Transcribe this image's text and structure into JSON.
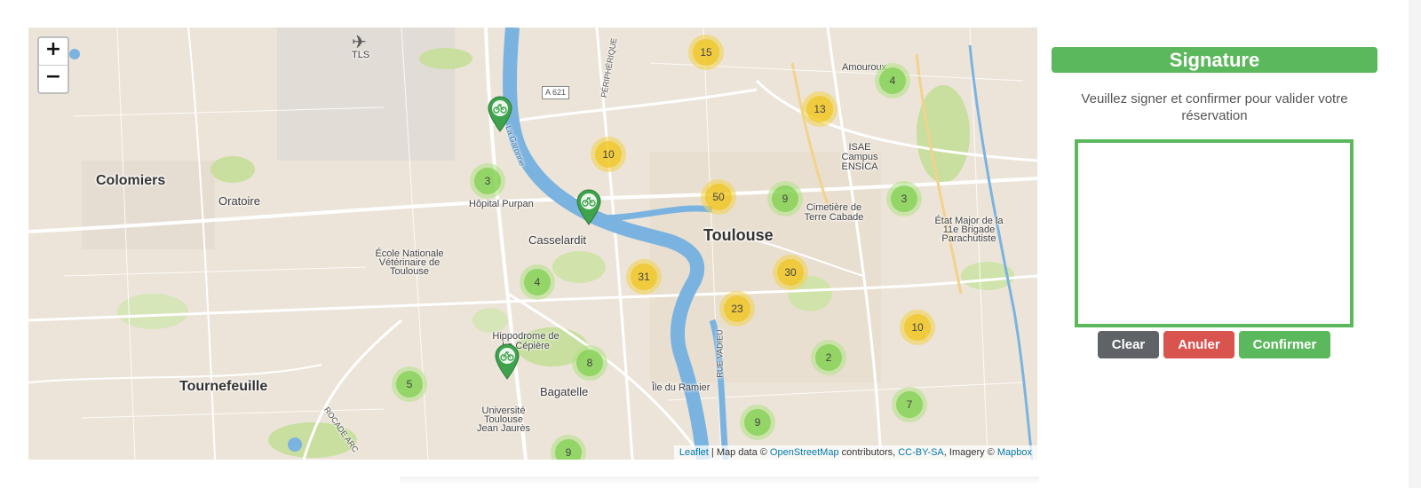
{
  "map": {
    "zoom_in_label": "+",
    "zoom_out_label": "−",
    "attribution": {
      "leaflet": "Leaflet",
      "sep1": " | Map data © ",
      "osm": "OpenStreetMap",
      "contributors": " contributors, ",
      "license": "CC-BY-SA",
      "imagery": ", Imagery © ",
      "mapbox": "Mapbox"
    },
    "places": [
      {
        "id": "tls",
        "text": "TLS"
      },
      {
        "id": "a621",
        "text": "A 621"
      },
      {
        "id": "colomiers",
        "text": "Colomiers"
      },
      {
        "id": "oratoire",
        "text": "Oratoire"
      },
      {
        "id": "hopital-purpan",
        "text": "Hôpital Purpan"
      },
      {
        "id": "casselardit",
        "text": "Casselardit"
      },
      {
        "id": "toulouse",
        "text": "Toulouse"
      },
      {
        "id": "ecole-veterinaire",
        "text": "École Nationale Vétérinaire de Toulouse"
      },
      {
        "id": "amouroux",
        "text": "Amouroux"
      },
      {
        "id": "isae",
        "text": "ISAE Campus ENSICA"
      },
      {
        "id": "cimetiere",
        "text": "Cimetière de Terre Cabade"
      },
      {
        "id": "etat-major",
        "text": "État Major de la 11e Brigade Parachutiste"
      },
      {
        "id": "hippodrome",
        "text": "Hippodrome de La Cépière"
      },
      {
        "id": "bagatelle",
        "text": "Bagatelle"
      },
      {
        "id": "ile-ramier",
        "text": "Île du Ramier"
      },
      {
        "id": "universite",
        "text": "Université Toulouse Jean Jaurès"
      },
      {
        "id": "tournefeuille",
        "text": "Tournefeuille"
      },
      {
        "id": "rue-vadieu",
        "text": "RUE VADIEU"
      },
      {
        "id": "rocade-arc",
        "text": "ROCADE ARC"
      },
      {
        "id": "garonne",
        "text": "La Garonne"
      },
      {
        "id": "peripherique",
        "text": "PÉRIPHÉRIQUE"
      }
    ],
    "clusters": [
      {
        "count": "15",
        "level": "medium"
      },
      {
        "count": "13",
        "level": "medium"
      },
      {
        "count": "4",
        "level": "small"
      },
      {
        "count": "10",
        "level": "medium"
      },
      {
        "count": "3",
        "level": "small"
      },
      {
        "count": "50",
        "level": "medium"
      },
      {
        "count": "9",
        "level": "small"
      },
      {
        "count": "3",
        "level": "small"
      },
      {
        "count": "30",
        "level": "medium"
      },
      {
        "count": "31",
        "level": "medium"
      },
      {
        "count": "4",
        "level": "small"
      },
      {
        "count": "23",
        "level": "medium"
      },
      {
        "count": "10",
        "level": "medium"
      },
      {
        "count": "8",
        "level": "small"
      },
      {
        "count": "2",
        "level": "small"
      },
      {
        "count": "5",
        "level": "small"
      },
      {
        "count": "7",
        "level": "small"
      },
      {
        "count": "9",
        "level": "small"
      },
      {
        "count": "9",
        "level": "small"
      }
    ],
    "colors": {
      "water": "#7bb3e0",
      "park": "#c8df9f",
      "cluster_small": "#6ecc39",
      "cluster_medium": "#f0c20c",
      "marker": "#3fa34d"
    }
  },
  "signature": {
    "title": "Signature",
    "instructions": "Veuillez signer et confirmer pour valider votre réservation",
    "buttons": {
      "clear": "Clear",
      "cancel": "Anuler",
      "confirm": "Confirmer"
    },
    "colors": {
      "primary": "#5cb85c",
      "danger": "#d9534f",
      "neutral": "#5f6266"
    }
  }
}
